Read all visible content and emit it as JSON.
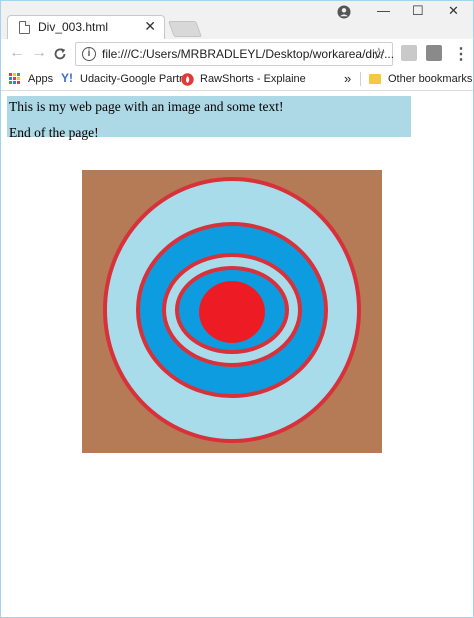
{
  "browser": {
    "tab_title": "Div_003.html",
    "tab_close": "✕",
    "url": "file:///C:/Users/MRBRADLEYL/Desktop/workarea/div/...",
    "window_controls": {
      "minimize": "—",
      "maximize": "☐",
      "close": "✕"
    }
  },
  "bookmarks": {
    "apps_label": "Apps",
    "items": [
      {
        "label": "Udacity-Google Partr",
        "icon": "yahoo-icon"
      },
      {
        "label": "RawShorts - Explaine",
        "icon": "rawshorts-icon"
      }
    ],
    "overflow": "»",
    "other": "Other bookmarks"
  },
  "page": {
    "line1": "This is my web page with an image and some text!",
    "line2": "End of the page!"
  },
  "colors": {
    "div_background": "#add8e6",
    "target_background": "#b57a56",
    "ring_light": "#a8dcea",
    "ring_dark": "#0d9ce0",
    "ring_red": "#d8313a",
    "bullseye": "#ed1c24"
  }
}
